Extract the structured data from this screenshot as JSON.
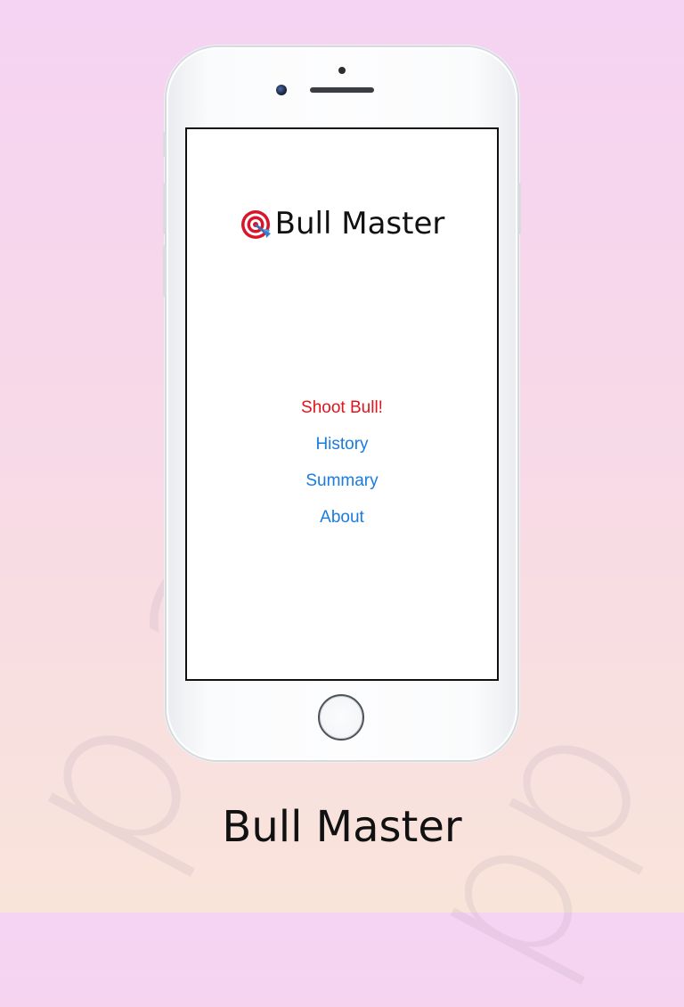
{
  "app": {
    "title": "Bull Master"
  },
  "menu": {
    "items": [
      {
        "label": "Shoot Bull!",
        "style": "primary"
      },
      {
        "label": "History",
        "style": "link"
      },
      {
        "label": "Summary",
        "style": "link"
      },
      {
        "label": "About",
        "style": "link"
      }
    ]
  },
  "footer": {
    "title": "Bull Master"
  },
  "watermark": {
    "text_1": "pre",
    "text_2": "p.app",
    "text_3": "pp"
  },
  "colors": {
    "primary_action": "#e0141a",
    "link": "#1a7be0",
    "text": "#111111"
  },
  "icons": {
    "title_icon": "target-dart-icon"
  }
}
